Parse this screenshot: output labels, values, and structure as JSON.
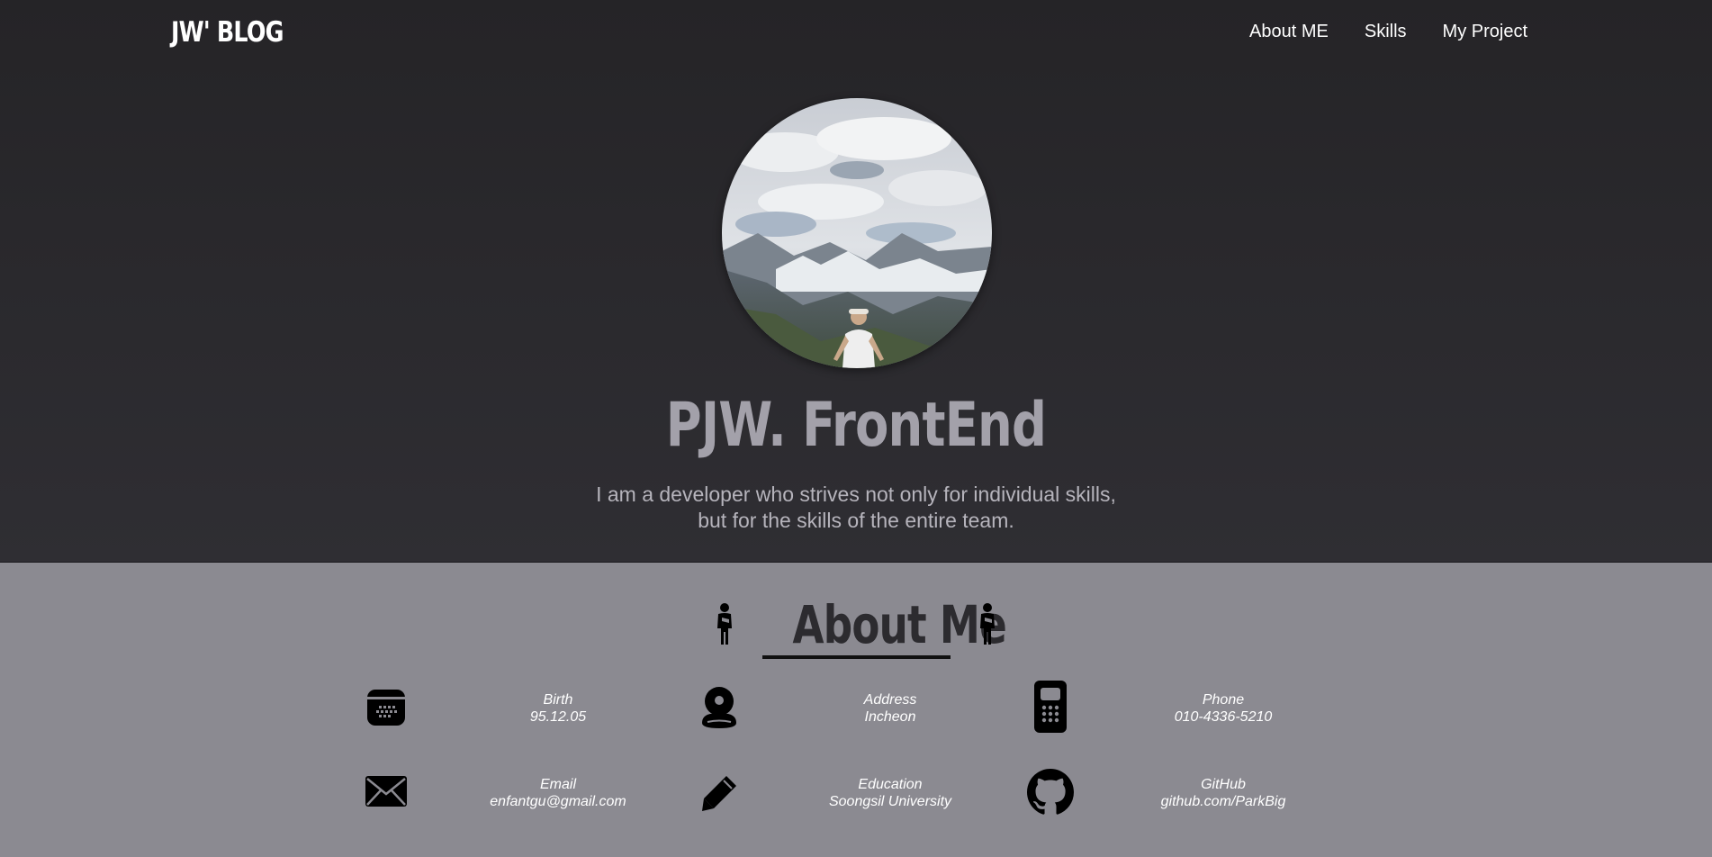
{
  "nav": {
    "brand": "JW' BLOG",
    "links": [
      "About ME",
      "Skills",
      "My Project"
    ]
  },
  "hero": {
    "title": "PJW. FrontEnd",
    "description_line1": "I am a developer who strives not only for individual skills,",
    "description_line2": "but for the skills of the entire team."
  },
  "about": {
    "title": "About Me",
    "items": [
      {
        "label": "Birth",
        "value": "95.12.05",
        "icon": "calendar-icon"
      },
      {
        "label": "Address",
        "value": "Incheon",
        "icon": "location-pin-icon"
      },
      {
        "label": "Phone",
        "value": "010-4336-5210",
        "icon": "mobile-phone-icon"
      },
      {
        "label": "Email",
        "value": "enfantgu@gmail.com",
        "icon": "envelope-icon"
      },
      {
        "label": "Education",
        "value": "Soongsil University",
        "icon": "pencil-icon"
      },
      {
        "label": "GitHub",
        "value": "github.com/ParkBig",
        "icon": "github-icon"
      }
    ]
  },
  "colors": {
    "hero_background": "#2a292d",
    "about_background": "#8b8a91",
    "title_gray": "#a3a1aa",
    "about_title": "#2c2b2f"
  }
}
